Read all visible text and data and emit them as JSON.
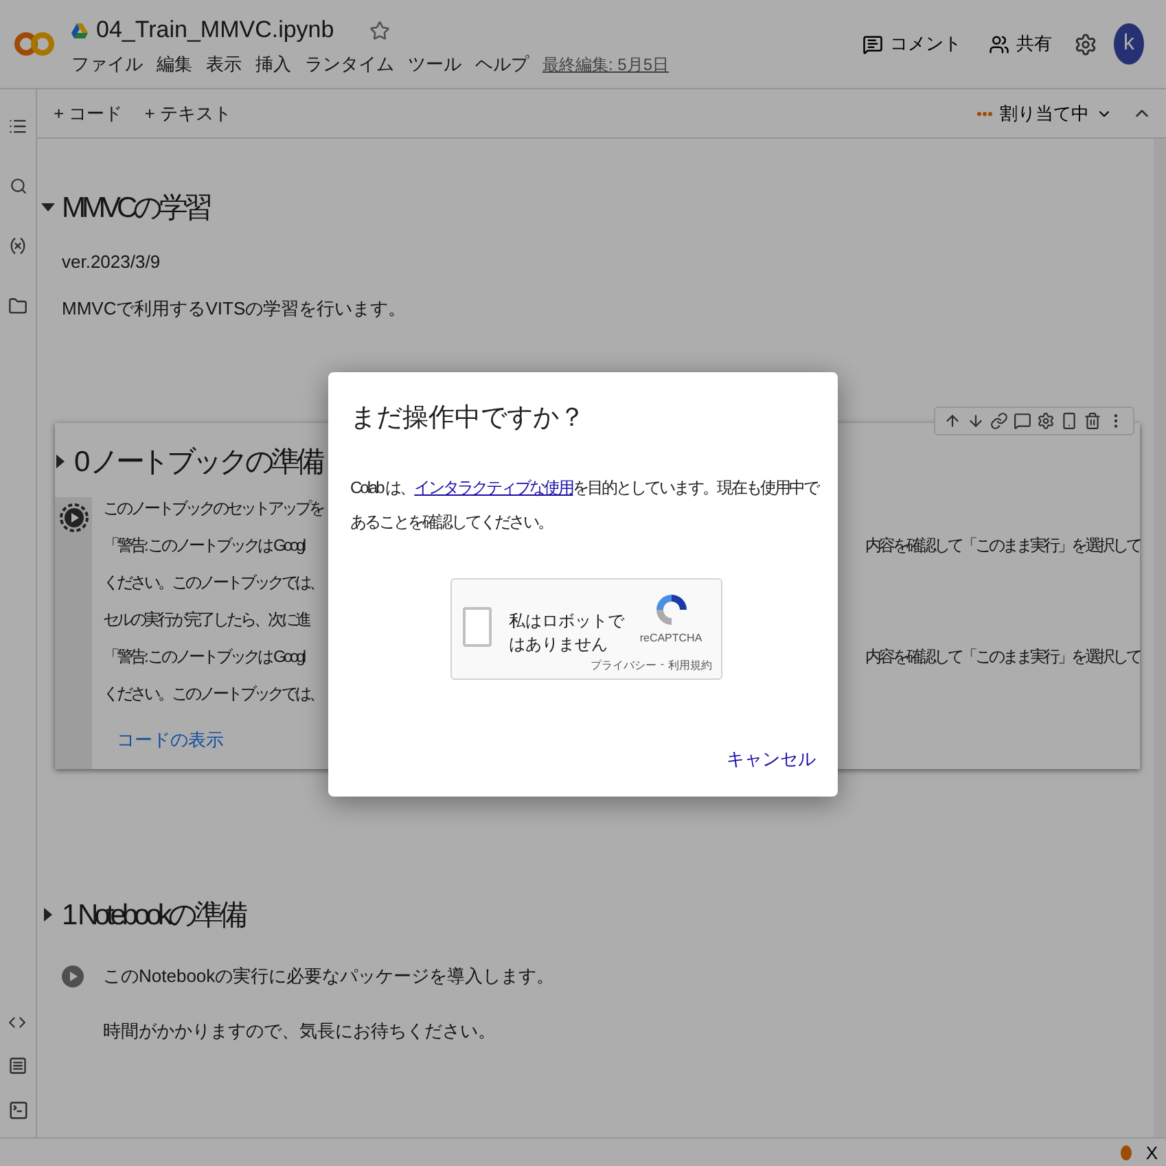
{
  "header": {
    "title": "04_Train_MMVC.ipynb",
    "starred": false,
    "menu": [
      "ファイル",
      "編集",
      "表示",
      "挿入",
      "ランタイム",
      "ツール",
      "ヘルプ"
    ],
    "last_edit": "最終編集: 5月5日",
    "actions": [
      {
        "kind": "comment",
        "label": "コメント"
      },
      {
        "kind": "share",
        "label": "共有"
      }
    ],
    "avatar": "k"
  },
  "toolbar": {
    "add": [
      "+ コード",
      "+ テキスト"
    ],
    "status": "割り当て中"
  },
  "notebook": [
    {
      "kind": "section",
      "heading": "MMVCの学習",
      "expanded": true,
      "paragraphs": [
        "ver.2023/3/9",
        "MMVCで利用するVITSの学習を行います。"
      ]
    },
    {
      "kind": "cell",
      "heading": "0 ノートブックの準備",
      "expanded": false,
      "lines": [
        {
          "left": "このノートブックのセットアップを"
        },
        {
          "left": "「警告: このノートブックは Googl",
          "right": "内容を確認して「このまま実行」を選択して"
        },
        {
          "left": "ください。このノートブックでは、"
        },
        {
          "left": "セルの実行が完了したら、次に進"
        },
        {
          "left": "「警告: このノートブックは Googl",
          "right": "内容を確認して「このまま実行」を選択して"
        },
        {
          "left": "ください。このノートブックでは、"
        }
      ],
      "link": "コードの表示"
    },
    {
      "kind": "section",
      "heading": "1 Notebookの準備",
      "expanded": false,
      "run_text": "このNotebookの実行に必要なパッケージを導入します。",
      "paragraphs": [
        "時間がかかりますので、気長にお待ちください。"
      ]
    }
  ],
  "status_bar": {
    "close": "X"
  },
  "dialog": {
    "title": "まだ操作中ですか？",
    "body_before": "Colab は、",
    "body_link": "インタラクティブな使用",
    "body_after": "を目的としています。現在も使用中であることを確認してください。",
    "captcha": {
      "label": "私はロボットではありません",
      "checked": false,
      "brand": "reCAPTCHA",
      "privacy": "プライバシー",
      "separator": "-",
      "terms": "利用規約"
    },
    "cancel": "キャンセル"
  }
}
